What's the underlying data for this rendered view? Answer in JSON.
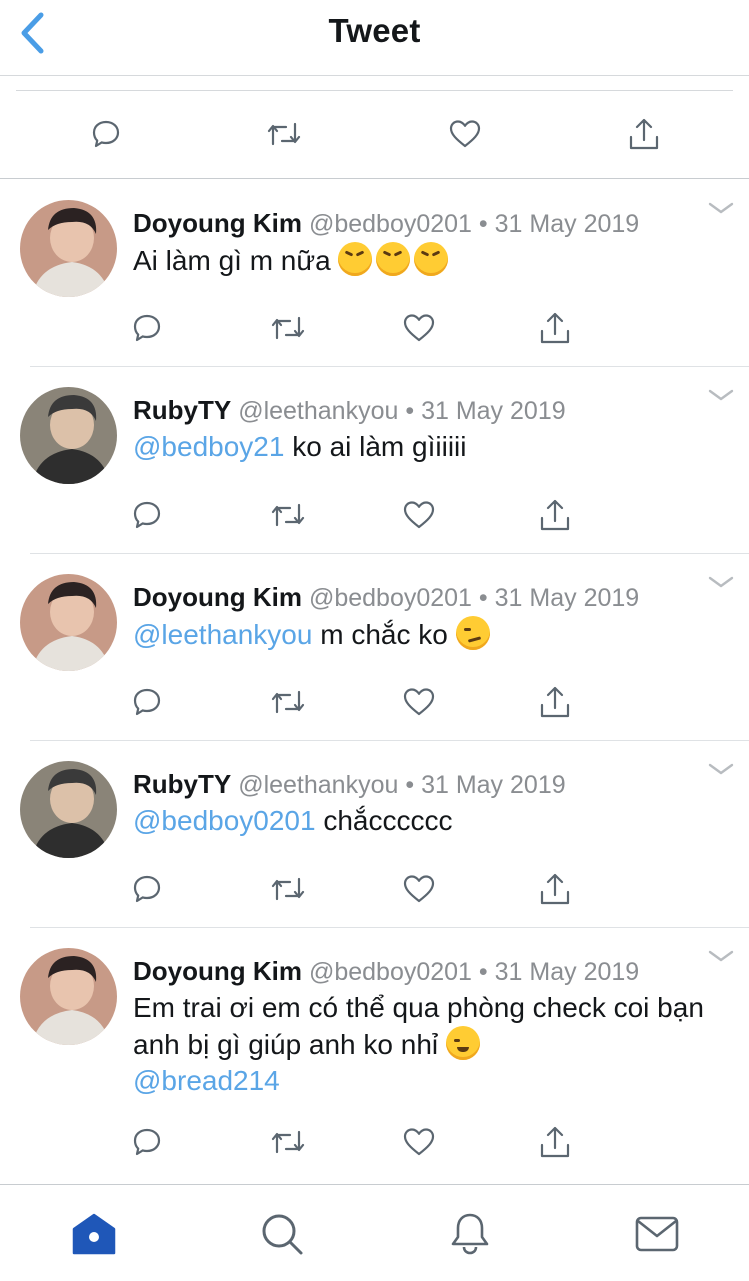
{
  "header": {
    "title": "Tweet",
    "back_icon": "chevron-left-icon",
    "accent_color": "#4a9de6"
  },
  "main_actions": [
    "reply-icon",
    "retweet-icon",
    "like-icon",
    "share-icon"
  ],
  "replies": [
    {
      "name": "Doyoung Kim",
      "handle": "@bedboy0201",
      "separator": "•",
      "date": "31 May 2019",
      "mention": "",
      "body": "Ai làm gì m nữa",
      "emojis": [
        "rolling-on-floor-laughing-emoji",
        "rolling-on-floor-laughing-emoji",
        "rolling-on-floor-laughing-emoji"
      ],
      "trailing_mention": ""
    },
    {
      "name": "RubyTY",
      "handle": "@leethankyou",
      "separator": "•",
      "date": "31 May 2019",
      "mention": "@bedboy21",
      "body": "ko ai làm gìiiiii",
      "emojis": [],
      "trailing_mention": ""
    },
    {
      "name": "Doyoung Kim",
      "handle": "@bedboy0201",
      "separator": "•",
      "date": "31 May 2019",
      "mention": "@leethankyou",
      "body": "m chắc ko",
      "emojis": [
        "smirking-face-emoji"
      ],
      "trailing_mention": ""
    },
    {
      "name": "RubyTY",
      "handle": "@leethankyou",
      "separator": "•",
      "date": "31 May 2019",
      "mention": "@bedboy0201",
      "body": "chắcccccc",
      "emojis": [],
      "trailing_mention": ""
    },
    {
      "name": "Doyoung Kim",
      "handle": "@bedboy0201",
      "separator": "•",
      "date": "31 May 2019",
      "mention": "",
      "body": "Em trai ơi em có thể qua phòng check coi bạn anh bị gì giúp anh ko nhỉ",
      "emojis": [
        "smiling-face-emoji"
      ],
      "trailing_mention": "@bread214"
    }
  ],
  "tabbar": {
    "active_tab": "home",
    "tabs": [
      "home-icon",
      "search-icon",
      "notifications-icon",
      "messages-icon"
    ],
    "active_color": "#1f57b8",
    "inactive_color": "#5b6670"
  }
}
